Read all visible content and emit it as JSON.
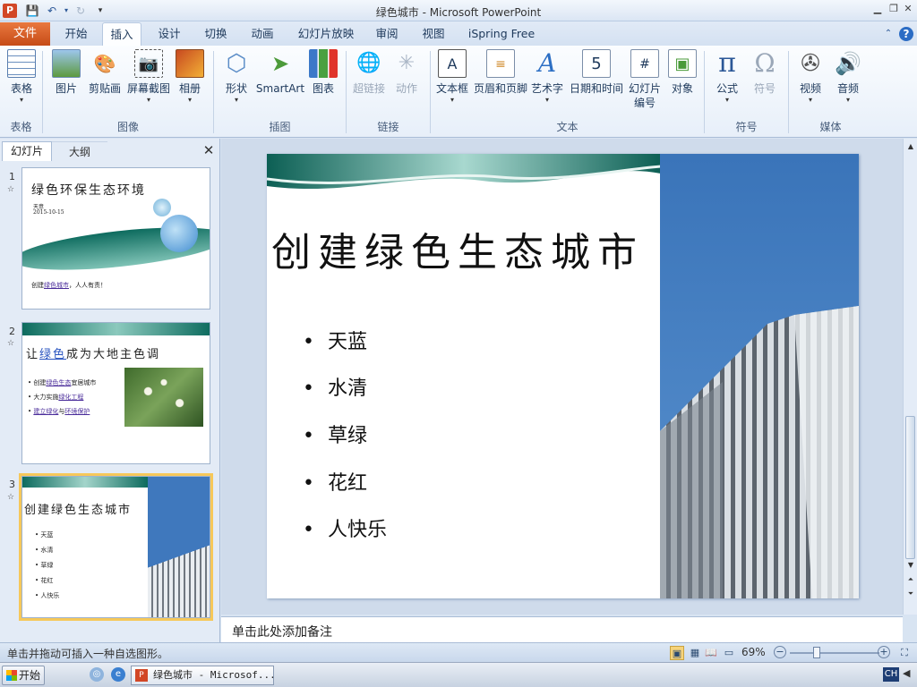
{
  "window": {
    "title": "绿色城市 - Microsoft PowerPoint",
    "app_icon_text": "P"
  },
  "tabs": {
    "file": "文件",
    "items": [
      "开始",
      "插入",
      "设计",
      "切换",
      "动画",
      "幻灯片放映",
      "审阅",
      "视图",
      "iSpring Free"
    ],
    "active": "插入"
  },
  "ribbon": {
    "buttons": {
      "table": "表格",
      "picture": "图片",
      "clipart": "剪贴画",
      "screenshot": "屏幕截图",
      "album": "相册",
      "shapes": "形状",
      "smartart": "SmartArt",
      "chart": "图表",
      "hyperlink": "超链接",
      "action": "动作",
      "textbox": "文本框",
      "header_footer": "页眉和页脚",
      "wordart": "艺术字",
      "datetime": "日期和时间",
      "slide_number": "幻灯片\n编号",
      "object": "对象",
      "equation": "公式",
      "symbol": "符号",
      "video": "视频",
      "audio": "音频"
    },
    "groups": {
      "tables": "表格",
      "images": "图像",
      "illustrations": "插图",
      "links": "链接",
      "text": "文本",
      "symbols": "符号",
      "media": "媒体"
    }
  },
  "left_pane": {
    "tab_slides": "幻灯片",
    "tab_outline": "大纲",
    "close": "✕",
    "numbers": [
      "1",
      "2",
      "3"
    ],
    "star": "☆"
  },
  "thumbnails": {
    "s1": {
      "title": "绿色环保生态环境",
      "author": "天意",
      "date": "2015-10-15",
      "caption_a": "创建",
      "caption_link": "绿色城市",
      "caption_b": "，人人有责！"
    },
    "s2": {
      "title_a": "让",
      "title_link": "绿色",
      "title_b": "成为大地主色调",
      "b1_a": "创建",
      "b1_link": "绿色生态",
      "b1_b": "宜居城市",
      "b2_a": "大力实施",
      "b2_link": "绿化工程",
      "b3_link": "建立绿化",
      "b3_b": "与",
      "b3_link2": "环境保护"
    }
  },
  "slide": {
    "title": "创建绿色生态城市",
    "bullets": [
      "天蓝",
      "水清",
      "草绿",
      "花红",
      "人快乐"
    ],
    "bullet_char": "•"
  },
  "notes": {
    "placeholder": "单击此处添加备注"
  },
  "status": {
    "hint": "单击并拖动可插入一种自选图形。",
    "zoom": "69%",
    "zoom_level_percent": 69
  },
  "taskbar": {
    "start": "开始",
    "task": "绿色城市 - Microsof...",
    "ime": "CH"
  },
  "colors": {
    "accent_file_tab": "#d24726",
    "selection": "#f6c85a",
    "ribbon_text": "#1e395b"
  }
}
